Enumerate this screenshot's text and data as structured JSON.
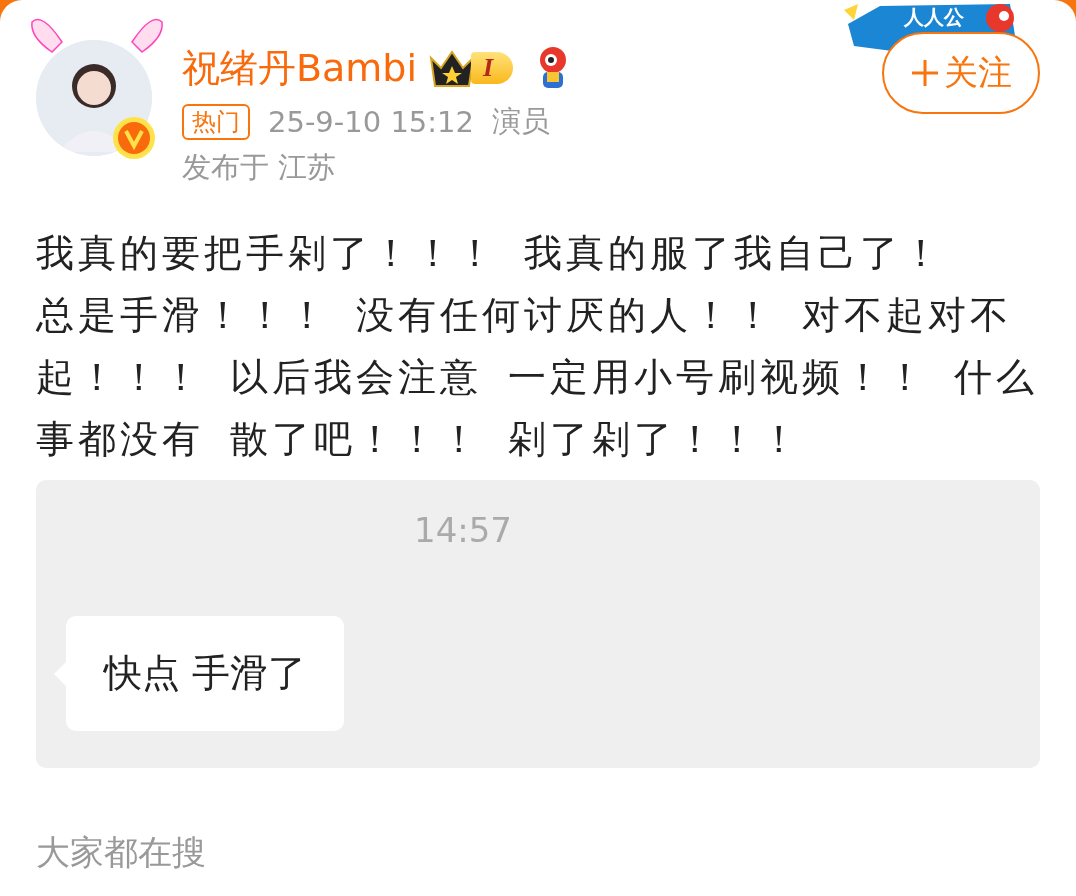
{
  "author": {
    "name": "祝绪丹Bambi",
    "level_badge": "I",
    "verified": true
  },
  "follow_button": {
    "label": "关注"
  },
  "campaign_banner": {
    "text": "人人公"
  },
  "meta": {
    "tag": "热门",
    "time": "25-9-10 15:12",
    "source": "演员",
    "location": "发布于 江苏"
  },
  "post": {
    "lines": [
      "我真的要把手剁了！！！ 我真的服了我自己了！",
      "总是手滑！！！ 没有任何讨厌的人！！ 对不起对不",
      "起！！！ 以后我会注意 一定用小号刷视频！！ 什么",
      "事都没有 散了吧！！！ 剁了剁了！！！"
    ]
  },
  "chat_screenshot": {
    "time": "14:57",
    "messages": [
      {
        "text": "快点 手滑了"
      }
    ]
  },
  "section_title": "大家都在搜"
}
